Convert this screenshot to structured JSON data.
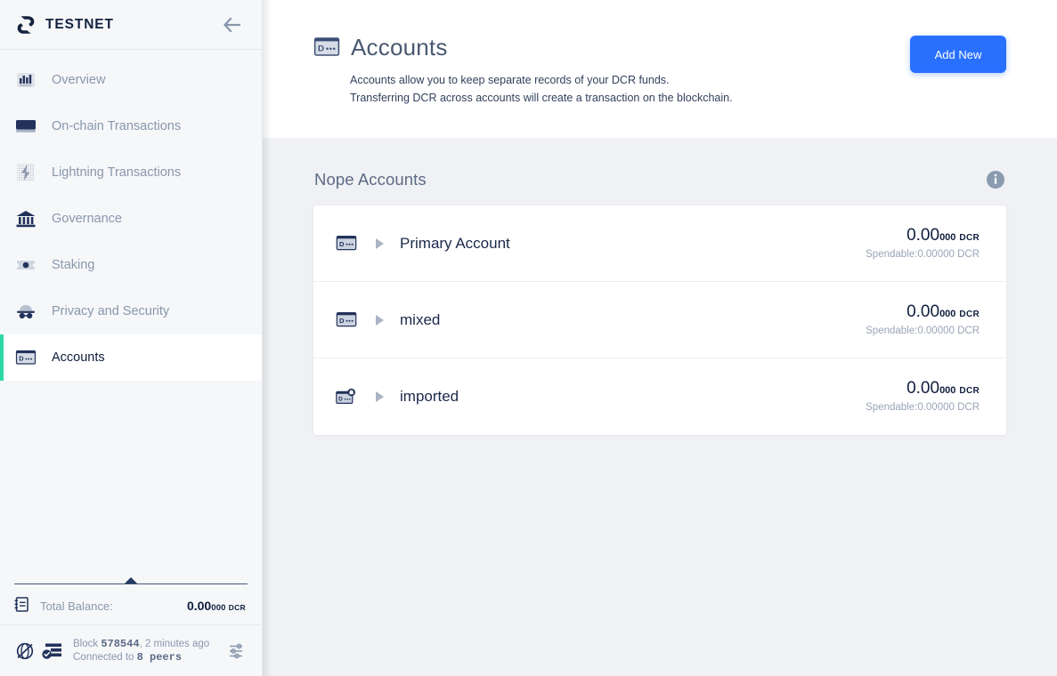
{
  "sidebar": {
    "brand": "TESTNET",
    "collapse_icon": "arrow-left-icon",
    "items": [
      {
        "label": "Overview",
        "icon": "chart-bars-icon",
        "active": false
      },
      {
        "label": "On-chain Transactions",
        "icon": "card-icon",
        "active": false
      },
      {
        "label": "Lightning Transactions",
        "icon": "lightning-bolt-icon",
        "active": false
      },
      {
        "label": "Governance",
        "icon": "bank-icon",
        "active": false
      },
      {
        "label": "Staking",
        "icon": "ticket-icon",
        "active": false
      },
      {
        "label": "Privacy and Security",
        "icon": "incognito-hat-icon",
        "active": false
      },
      {
        "label": "Accounts",
        "icon": "account-card-icon",
        "active": true
      }
    ],
    "total_balance": {
      "label": "Total Balance:",
      "amount_major": "0.00",
      "amount_minor": "000",
      "unit": "DCR"
    },
    "status": {
      "block_label": "Block",
      "block_number": "578544",
      "block_age": ", 2 minutes ago",
      "connected_label": "Connected to",
      "peers": "8 peers",
      "settings_icon": "sliders-icon"
    }
  },
  "header": {
    "icon": "account-card-icon",
    "title": "Accounts",
    "description_line1": "Accounts allow you to keep separate records of your DCR funds.",
    "description_line2": "Transferring DCR across accounts will create a transaction on the blockchain.",
    "add_new_label": "Add New"
  },
  "accounts_section": {
    "title": "Nope Accounts",
    "info_icon": "info-circle-icon",
    "spendable_prefix": "Spendable:",
    "rows": [
      {
        "name": "Primary Account",
        "icon": "account-card-icon",
        "caret": "triangle-right-icon",
        "amount_major": "0.00",
        "amount_minor": "000",
        "unit": "DCR",
        "spendable": "Spendable:0.00000 DCR"
      },
      {
        "name": "mixed",
        "icon": "account-card-icon",
        "caret": "triangle-right-icon",
        "amount_major": "0.00",
        "amount_minor": "000",
        "unit": "DCR",
        "spendable": "Spendable:0.00000 DCR"
      },
      {
        "name": "imported",
        "icon": "account-card-imported-icon",
        "caret": "triangle-right-icon",
        "amount_major": "0.00",
        "amount_minor": "000",
        "unit": "DCR",
        "spendable": "Spendable:0.00000 DCR"
      }
    ]
  },
  "colors": {
    "accent_blue": "#2970ff",
    "accent_green": "#2ed8a3",
    "navy": "#0f1e3d",
    "muted": "#8997ad",
    "sidebar_bg": "#f6f7f9",
    "content_bg": "#f0f1f4"
  }
}
